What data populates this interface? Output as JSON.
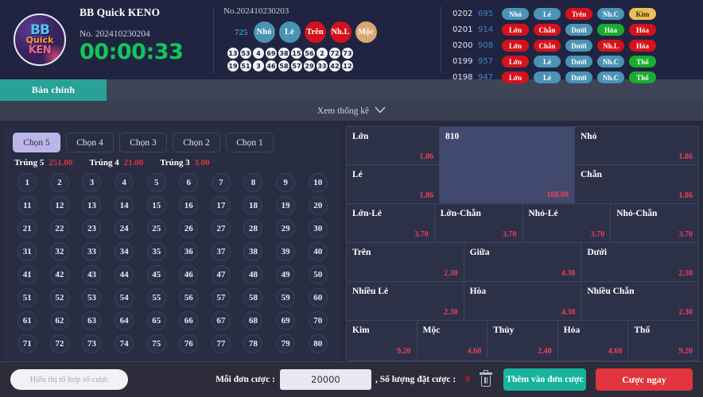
{
  "header": {
    "logo": {
      "line1": "BB",
      "line2": "Quick",
      "line3": "KEN"
    },
    "game_title": "BB Quick KENO",
    "issue_label": "No. 202410230204",
    "countdown": "00:00:33",
    "last_draw": {
      "issue_label": "No.202410230203",
      "sum": "725",
      "tags": [
        {
          "label": "Nhỏ",
          "color": "#4a93b5",
          "style": "c-blue"
        },
        {
          "label": "Lẻ",
          "color": "#4a93b5",
          "style": "c-blue"
        },
        {
          "label": "Trên",
          "color": "#d3121b",
          "style": "c-red"
        },
        {
          "label": "Nh.L",
          "color": "#d3121b",
          "style": "c-red"
        },
        {
          "label": "Mộc",
          "color": "#d8a871",
          "style": "c-gold"
        }
      ],
      "balls_row1": [
        "13",
        "53",
        "4",
        "69",
        "38",
        "15",
        "56",
        "2",
        "72",
        "73"
      ],
      "balls_row2": [
        "19",
        "51",
        "3",
        "46",
        "58",
        "57",
        "29",
        "33",
        "42",
        "12"
      ]
    },
    "history": [
      {
        "id": "0202",
        "sum": "695",
        "pills": [
          {
            "label": "Nhỏ",
            "style": "p-blue"
          },
          {
            "label": "Lẻ",
            "style": "p-blue"
          },
          {
            "label": "Trên",
            "style": "p-red"
          },
          {
            "label": "Nh.C",
            "style": "p-blue"
          },
          {
            "label": "Kim",
            "style": "p-gold"
          }
        ]
      },
      {
        "id": "0201",
        "sum": "914",
        "pills": [
          {
            "label": "Lớn",
            "style": "p-red"
          },
          {
            "label": "Chẵn",
            "style": "p-red"
          },
          {
            "label": "Dưới",
            "style": "p-blue"
          },
          {
            "label": "Hỏa",
            "style": "p-green"
          },
          {
            "label": "Hỏa",
            "style": "p-red"
          }
        ]
      },
      {
        "id": "0200",
        "sum": "908",
        "pills": [
          {
            "label": "Lớn",
            "style": "p-red"
          },
          {
            "label": "Chẵn",
            "style": "p-red"
          },
          {
            "label": "Dưới",
            "style": "p-blue"
          },
          {
            "label": "Nh.L",
            "style": "p-red"
          },
          {
            "label": "Hỏa",
            "style": "p-red"
          }
        ]
      },
      {
        "id": "0199",
        "sum": "957",
        "pills": [
          {
            "label": "Lớn",
            "style": "p-red"
          },
          {
            "label": "Lẻ",
            "style": "p-blue"
          },
          {
            "label": "Dưới",
            "style": "p-blue"
          },
          {
            "label": "Nh.C",
            "style": "p-blue"
          },
          {
            "label": "Thổ",
            "style": "p-green"
          }
        ]
      },
      {
        "id": "0198",
        "sum": "947",
        "pills": [
          {
            "label": "Lớn",
            "style": "p-red"
          },
          {
            "label": "Lẻ",
            "style": "p-blue"
          },
          {
            "label": "Dưới",
            "style": "p-blue"
          },
          {
            "label": "Nh.C",
            "style": "p-blue"
          },
          {
            "label": "Thổ",
            "style": "p-green"
          }
        ]
      }
    ]
  },
  "nav": {
    "active_tab": "Bàn chính"
  },
  "stats_bar": {
    "label": "Xem thống kê",
    "chevron": "⌄"
  },
  "left_panel": {
    "choose_tabs": [
      {
        "label": "Chọn 5",
        "active": true
      },
      {
        "label": "Chọn 4",
        "active": false
      },
      {
        "label": "Chọn 3",
        "active": false
      },
      {
        "label": "Chọn 2",
        "active": false
      },
      {
        "label": "Chọn 1",
        "active": false
      }
    ],
    "payouts": [
      {
        "label": "Trúng 5",
        "value": "251.00"
      },
      {
        "label": "Trúng 4",
        "value": "21.00"
      },
      {
        "label": "Trúng 3",
        "value": "3.00"
      }
    ],
    "numbers": [
      "1",
      "2",
      "3",
      "4",
      "5",
      "6",
      "7",
      "8",
      "9",
      "10",
      "11",
      "12",
      "13",
      "14",
      "15",
      "16",
      "17",
      "18",
      "19",
      "20",
      "21",
      "22",
      "23",
      "24",
      "25",
      "26",
      "27",
      "28",
      "29",
      "30",
      "31",
      "32",
      "33",
      "34",
      "35",
      "36",
      "37",
      "38",
      "39",
      "40",
      "41",
      "42",
      "43",
      "44",
      "45",
      "46",
      "47",
      "48",
      "49",
      "50",
      "51",
      "52",
      "53",
      "54",
      "55",
      "56",
      "57",
      "58",
      "59",
      "60",
      "61",
      "62",
      "63",
      "64",
      "65",
      "66",
      "67",
      "68",
      "69",
      "70",
      "71",
      "72",
      "73",
      "74",
      "75",
      "76",
      "77",
      "78",
      "79",
      "80"
    ]
  },
  "bet_panel": {
    "block1": {
      "col_left": [
        {
          "label": "Lớn",
          "odds": "1.86"
        },
        {
          "label": "Lẻ",
          "odds": "1.86"
        }
      ],
      "middle": {
        "label": "810",
        "odds": "108.00",
        "highlighted": true
      },
      "col_right": [
        {
          "label": "Nhỏ",
          "odds": "1.86"
        },
        {
          "label": "Chẵn",
          "odds": "1.86"
        }
      ]
    },
    "row_combo": [
      {
        "label": "Lớn-Lẻ",
        "odds": "3.70"
      },
      {
        "label": "Lớn-Chẵn",
        "odds": "3.70"
      },
      {
        "label": "Nhỏ-Lẻ",
        "odds": "3.70"
      },
      {
        "label": "Nhỏ-Chẵn",
        "odds": "3.70"
      }
    ],
    "row_position": [
      {
        "label": "Trên",
        "odds": "2.30"
      },
      {
        "label": "Giữa",
        "odds": "4.30"
      },
      {
        "label": "Dưới",
        "odds": "2.30"
      }
    ],
    "row_parity": [
      {
        "label": "Nhiều Lẻ",
        "odds": "2.30"
      },
      {
        "label": "Hòa",
        "odds": "4.30"
      },
      {
        "label": "Nhiều Chẵn",
        "odds": "2.30"
      }
    ],
    "row_elements": [
      {
        "label": "Kim",
        "odds": "9.20"
      },
      {
        "label": "Mộc",
        "odds": "4.60"
      },
      {
        "label": "Thủy",
        "odds": "2.40"
      },
      {
        "label": "Hỏa",
        "odds": "4.60"
      },
      {
        "label": "Thổ",
        "odds": "9.20"
      }
    ]
  },
  "footer": {
    "combo_button": "Hiển thị tổ hợp số cược",
    "per_bet_label": "Mỗi đơn cược :",
    "amount_value": "20000",
    "count_label": ", Số lượng đặt cược :",
    "count_value": "0",
    "trash_icon": "trash-icon",
    "add_button": "Thêm vào đơn cược",
    "bet_button": "Cược ngay"
  }
}
